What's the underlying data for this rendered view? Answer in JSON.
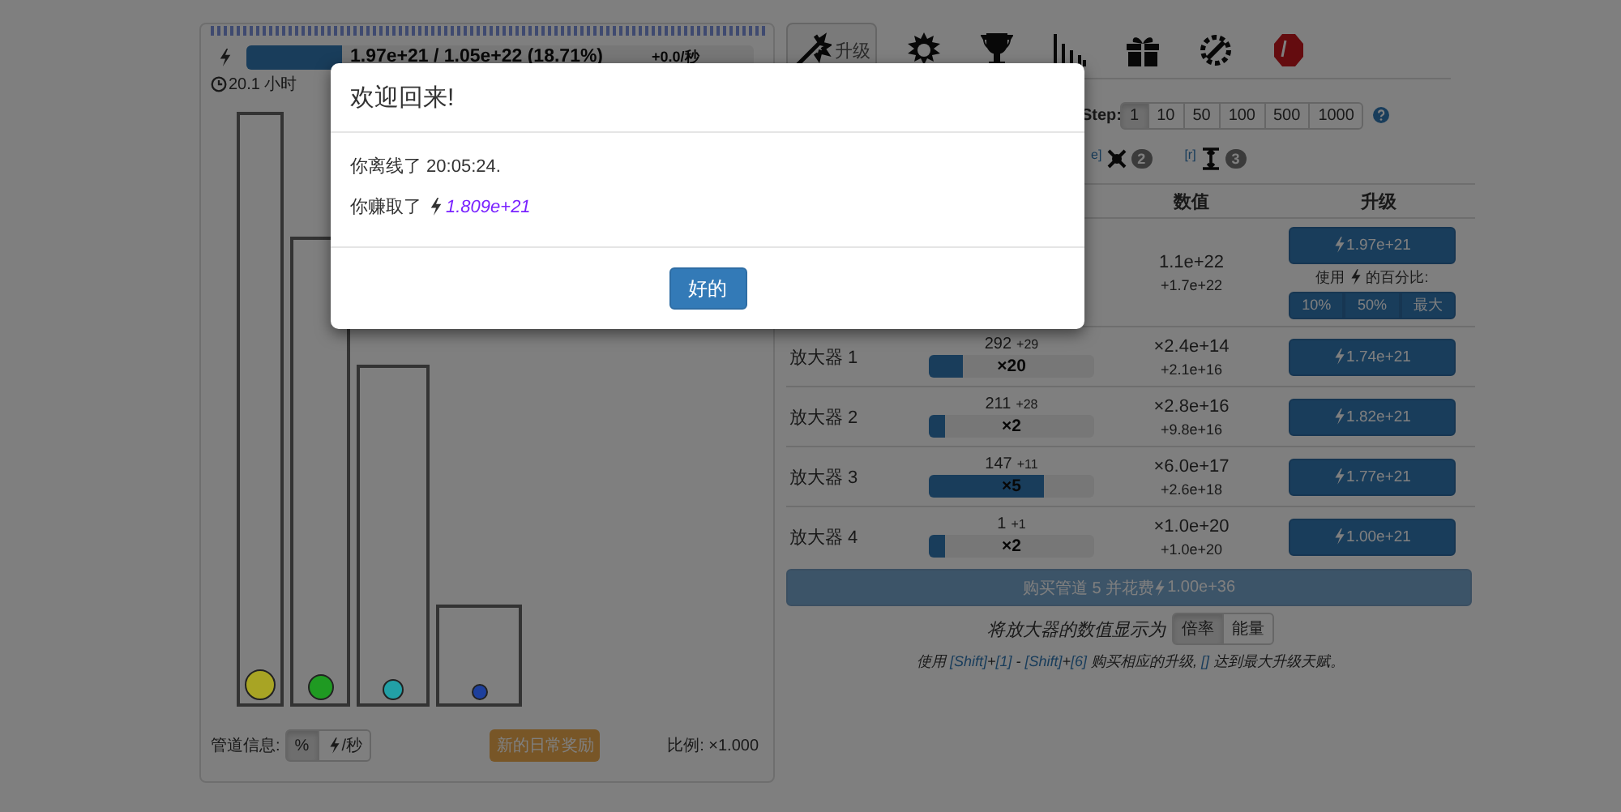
{
  "energy": {
    "text": "1.97e+21 / 1.05e+22 (18.71%)",
    "rate": "+0.0/秒",
    "level": 0.1871
  },
  "time_left": "20.1 小时",
  "pipes": [
    {
      "color": "#a8a424"
    },
    {
      "color": "#1f9a22"
    },
    {
      "color": "#22a0a6"
    },
    {
      "color": "#1d3f9c"
    }
  ],
  "pipe_info": {
    "label": "管道信息:",
    "options": [
      {
        "label": "%",
        "selected": true
      },
      {
        "label": "/秒",
        "selected": false
      }
    ]
  },
  "daily_reward": "新的日常奖励",
  "scale": "比例: ×1.000",
  "tabs": [
    {
      "label": "升级",
      "selected": true
    },
    {
      "selected": false
    },
    {
      "selected": false
    },
    {
      "selected": false
    },
    {
      "selected": false
    },
    {
      "selected": false
    },
    {
      "selected": false
    }
  ],
  "step": {
    "label": "Step:",
    "options": [
      {
        "label": "1",
        "selected": true
      },
      {
        "label": "10",
        "selected": false
      },
      {
        "label": "50",
        "selected": false
      },
      {
        "label": "100",
        "selected": false
      },
      {
        "label": "500",
        "selected": false
      },
      {
        "label": "1000",
        "selected": false
      }
    ]
  },
  "hotkeys": [
    {
      "key": "e]",
      "count": "2"
    },
    {
      "key": "[r]",
      "count": "3"
    }
  ],
  "table": {
    "columns": [
      "数值",
      "升级"
    ]
  },
  "pipe_upgrade": {
    "value": "1.1e+22",
    "delta": "+1.7e+22",
    "cost": "1.97e+21",
    "percent_label_before": "使用",
    "percent_label_after": "的百分比:",
    "percent_buttons": [
      "10%",
      "50%",
      "最大"
    ]
  },
  "amplifiers": [
    {
      "name": "放大器 1",
      "count": "292",
      "inc": "+29",
      "level": 0.21,
      "mult": "×20",
      "value": "×2.4e+14",
      "delta": "+2.1e+16",
      "cost": "1.74e+21"
    },
    {
      "name": "放大器 2",
      "count": "211",
      "inc": "+28",
      "level": 0.1,
      "mult": "×2",
      "value": "×2.8e+16",
      "delta": "+9.8e+16",
      "cost": "1.82e+21"
    },
    {
      "name": "放大器 3",
      "count": "147",
      "inc": "+11",
      "level": 0.7,
      "mult": "×5",
      "value": "×6.0e+17",
      "delta": "+2.6e+18",
      "cost": "1.77e+21"
    },
    {
      "name": "放大器 4",
      "count": "1",
      "inc": "+1",
      "level": 0.1,
      "mult": "×2",
      "value": "×1.0e+20",
      "delta": "+1.0e+20",
      "cost": "1.00e+21"
    }
  ],
  "buy_pipe": {
    "label": "购买管道 5 并花费",
    "cost": "1.00e+36",
    "disabled": true
  },
  "display_mode": {
    "label": "将放大器的数值显示为",
    "options": [
      {
        "label": "倍率",
        "selected": true
      },
      {
        "label": "能量",
        "selected": false
      }
    ]
  },
  "hint": [
    {
      "kind": "plain",
      "text": "使用 "
    },
    {
      "kind": "key",
      "text": "[Shift]"
    },
    {
      "kind": "plain",
      "text": "+"
    },
    {
      "kind": "key",
      "text": "[1]"
    },
    {
      "kind": "plain",
      "text": " - "
    },
    {
      "kind": "key",
      "text": "[Shift]"
    },
    {
      "kind": "plain",
      "text": "+"
    },
    {
      "kind": "key",
      "text": "[6]"
    },
    {
      "kind": "plain",
      "text": " 购买相应的升级, "
    },
    {
      "kind": "key",
      "text": "[]"
    },
    {
      "kind": "plain",
      "text": " 达到最大升级天赋。"
    }
  ],
  "modal": {
    "title": "欢迎回来!",
    "offline": "你离线了 20:05:24.",
    "earned_label": "你赚取了",
    "earned_amount": "1.809e+21",
    "ok": "好的"
  }
}
